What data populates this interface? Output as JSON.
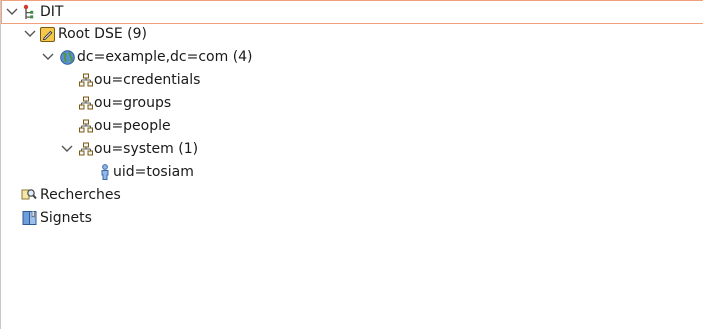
{
  "tree": {
    "dit": {
      "label": "DIT",
      "expanded": true,
      "icon": "dit-icon"
    },
    "root_dse": {
      "label": "Root DSE (9)",
      "expanded": true,
      "icon": "root-dse-icon"
    },
    "dc_example": {
      "label": "dc=example,dc=com (4)",
      "expanded": true,
      "icon": "globe-icon"
    },
    "ou_credentials": {
      "label": "ou=credentials",
      "icon": "org-unit-icon"
    },
    "ou_groups": {
      "label": "ou=groups",
      "icon": "org-unit-icon"
    },
    "ou_people": {
      "label": "ou=people",
      "icon": "org-unit-icon"
    },
    "ou_system": {
      "label": "ou=system (1)",
      "expanded": true,
      "icon": "org-unit-icon"
    },
    "uid_tosiam": {
      "label": "uid=tosiam",
      "icon": "person-icon"
    },
    "recherches": {
      "label": "Recherches",
      "icon": "searches-icon"
    },
    "signets": {
      "label": "Signets",
      "icon": "bookmarks-icon"
    }
  },
  "colors": {
    "selection_border": "#f0a07a",
    "twisty": "#555555",
    "text": "#1a1a1a"
  }
}
